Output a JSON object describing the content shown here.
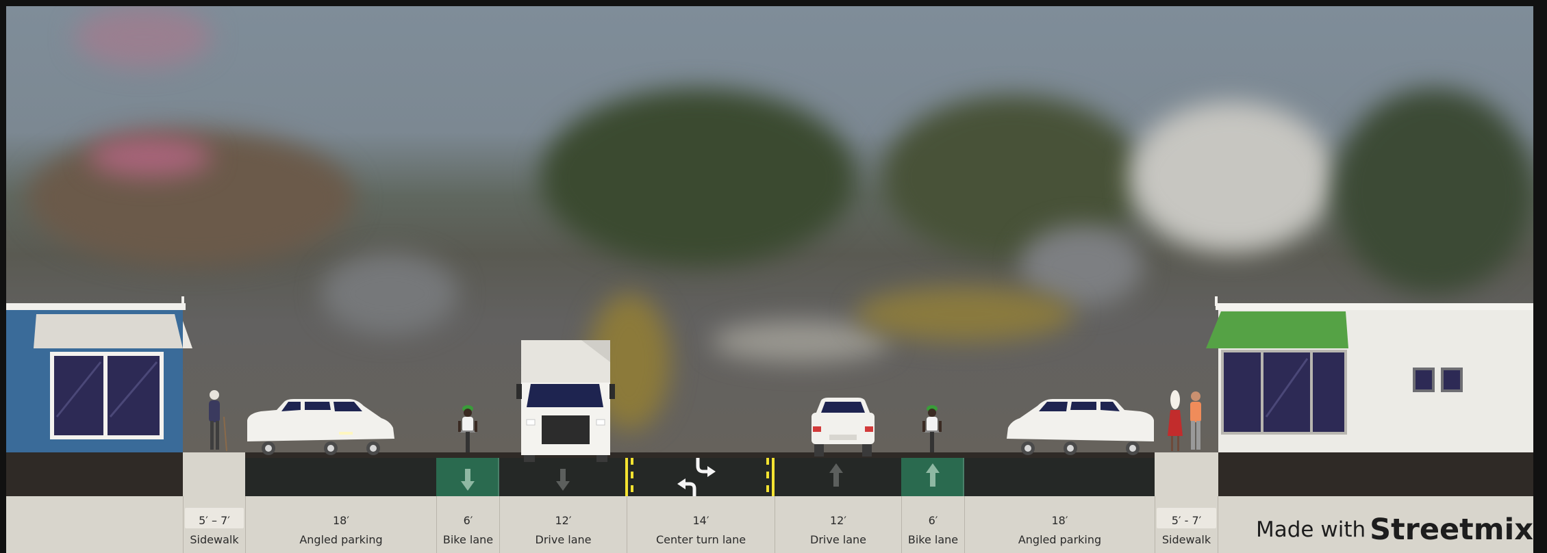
{
  "segments": [
    {
      "width": "5′ – 7′",
      "name": "Sidewalk"
    },
    {
      "width": "18′",
      "name": "Angled parking"
    },
    {
      "width": "6′",
      "name": "Bike lane"
    },
    {
      "width": "12′",
      "name": "Drive lane"
    },
    {
      "width": "14′",
      "name": "Center turn lane"
    },
    {
      "width": "12′",
      "name": "Drive lane"
    },
    {
      "width": "6′",
      "name": "Bike lane"
    },
    {
      "width": "18′",
      "name": "Angled parking"
    },
    {
      "width": "5′ - 7′",
      "name": "Sidewalk"
    }
  ],
  "watermark": {
    "prefix": "Made with",
    "brand": "Streetmix"
  },
  "colors": {
    "asphalt": "#252826",
    "bike_lane": "#2a6a4f",
    "curb_dirt": "#2f2a26",
    "sidewalk": "#d8d5cc",
    "lane_marking_yellow": "#f4e331",
    "building_left": "#3a6b99",
    "awning_right": "#55a245"
  }
}
